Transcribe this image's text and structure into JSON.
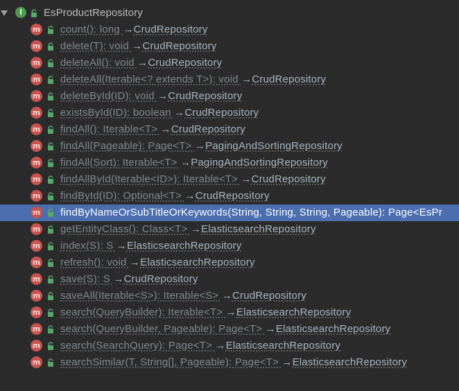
{
  "colors": {
    "background": "#2b2b2b",
    "selection": "#4b6eaf",
    "method_icon": "#c75450",
    "interface_icon": "#4e9a4e",
    "lock_icon": "#59a869",
    "inherited_text": "#818a8f",
    "owner_text": "#a9b7c6"
  },
  "root": {
    "expand_icon": "triangle-down-icon",
    "type_icon": "interface-icon",
    "type_icon_letter": "I",
    "access_icon": "lock-icon",
    "name": "EsProductRepository"
  },
  "method_icon_letter": "m",
  "arrow": "→",
  "methods": [
    {
      "signature": "count(): long ",
      "owner": "CrudRepository",
      "selected": false
    },
    {
      "signature": "delete(T): void ",
      "owner": "CrudRepository",
      "selected": false
    },
    {
      "signature": "deleteAll(): void ",
      "owner": "CrudRepository",
      "selected": false
    },
    {
      "signature": "deleteAll(Iterable<? extends T>): void ",
      "owner": "CrudRepository",
      "selected": false
    },
    {
      "signature": "deleteById(ID): void ",
      "owner": "CrudRepository",
      "selected": false
    },
    {
      "signature": "existsById(ID): boolean ",
      "owner": "CrudRepository",
      "selected": false
    },
    {
      "signature": "findAll(): Iterable<T> ",
      "owner": "CrudRepository",
      "selected": false
    },
    {
      "signature": "findAll(Pageable): Page<T> ",
      "owner": "PagingAndSortingRepository",
      "selected": false
    },
    {
      "signature": "findAll(Sort): Iterable<T> ",
      "owner": "PagingAndSortingRepository",
      "selected": false
    },
    {
      "signature": "findAllById(Iterable<ID>): Iterable<T> ",
      "owner": "CrudRepository",
      "selected": false
    },
    {
      "signature": "findById(ID): Optional<T> ",
      "owner": "CrudRepository",
      "selected": false
    },
    {
      "signature": "findByNameOrSubTitleOrKeywords(String, String, String, Pageable): Page<EsPr",
      "owner": "",
      "selected": true
    },
    {
      "signature": "getEntityClass(): Class<T> ",
      "owner": "ElasticsearchRepository",
      "selected": false
    },
    {
      "signature": "index(S): S ",
      "owner": "ElasticsearchRepository",
      "selected": false
    },
    {
      "signature": "refresh(): void ",
      "owner": "ElasticsearchRepository",
      "selected": false
    },
    {
      "signature": "save(S): S ",
      "owner": "CrudRepository",
      "selected": false
    },
    {
      "signature": "saveAll(Iterable<S>): Iterable<S> ",
      "owner": "CrudRepository",
      "selected": false
    },
    {
      "signature": "search(QueryBuilder): Iterable<T> ",
      "owner": "ElasticsearchRepository",
      "selected": false
    },
    {
      "signature": "search(QueryBuilder, Pageable): Page<T> ",
      "owner": "ElasticsearchRepository",
      "selected": false
    },
    {
      "signature": "search(SearchQuery): Page<T> ",
      "owner": "ElasticsearchRepository",
      "selected": false
    },
    {
      "signature": "searchSimilar(T, String[], Pageable): Page<T> ",
      "owner": "ElasticsearchRepository",
      "selected": false
    }
  ]
}
